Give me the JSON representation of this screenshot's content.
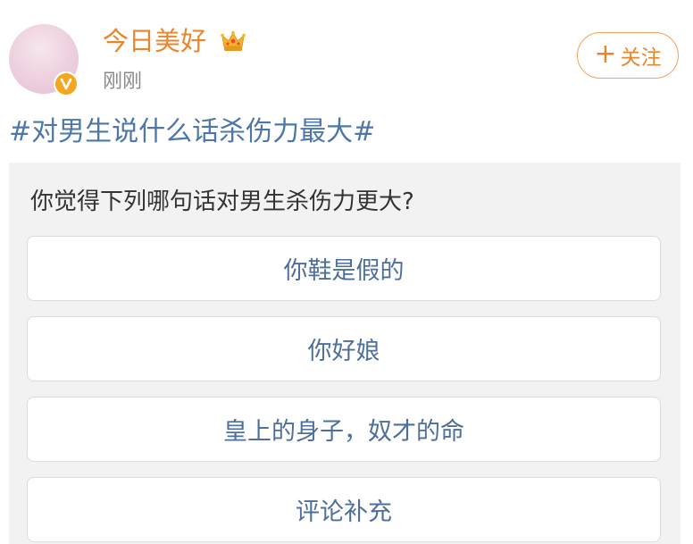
{
  "post": {
    "username": "今日美好",
    "time": "刚刚",
    "follow_label": "关注",
    "hashtag": "#对男生说什么话杀伤力最大#"
  },
  "icons": {
    "verified": "verified-v-icon",
    "crown": "crown-icon",
    "plus": "plus-icon"
  },
  "colors": {
    "username": "#e8862c",
    "link": "#4d77a8",
    "option_text": "#4d6f9a",
    "card_bg": "#f2f2f2",
    "badge": "#f3a620"
  },
  "poll": {
    "question": "你觉得下列哪句话对男生杀伤力更大?",
    "options": [
      {
        "label": "你鞋是假的"
      },
      {
        "label": "你好娘"
      },
      {
        "label": "皇上的身子，奴才的命"
      },
      {
        "label": "评论补充"
      }
    ]
  }
}
